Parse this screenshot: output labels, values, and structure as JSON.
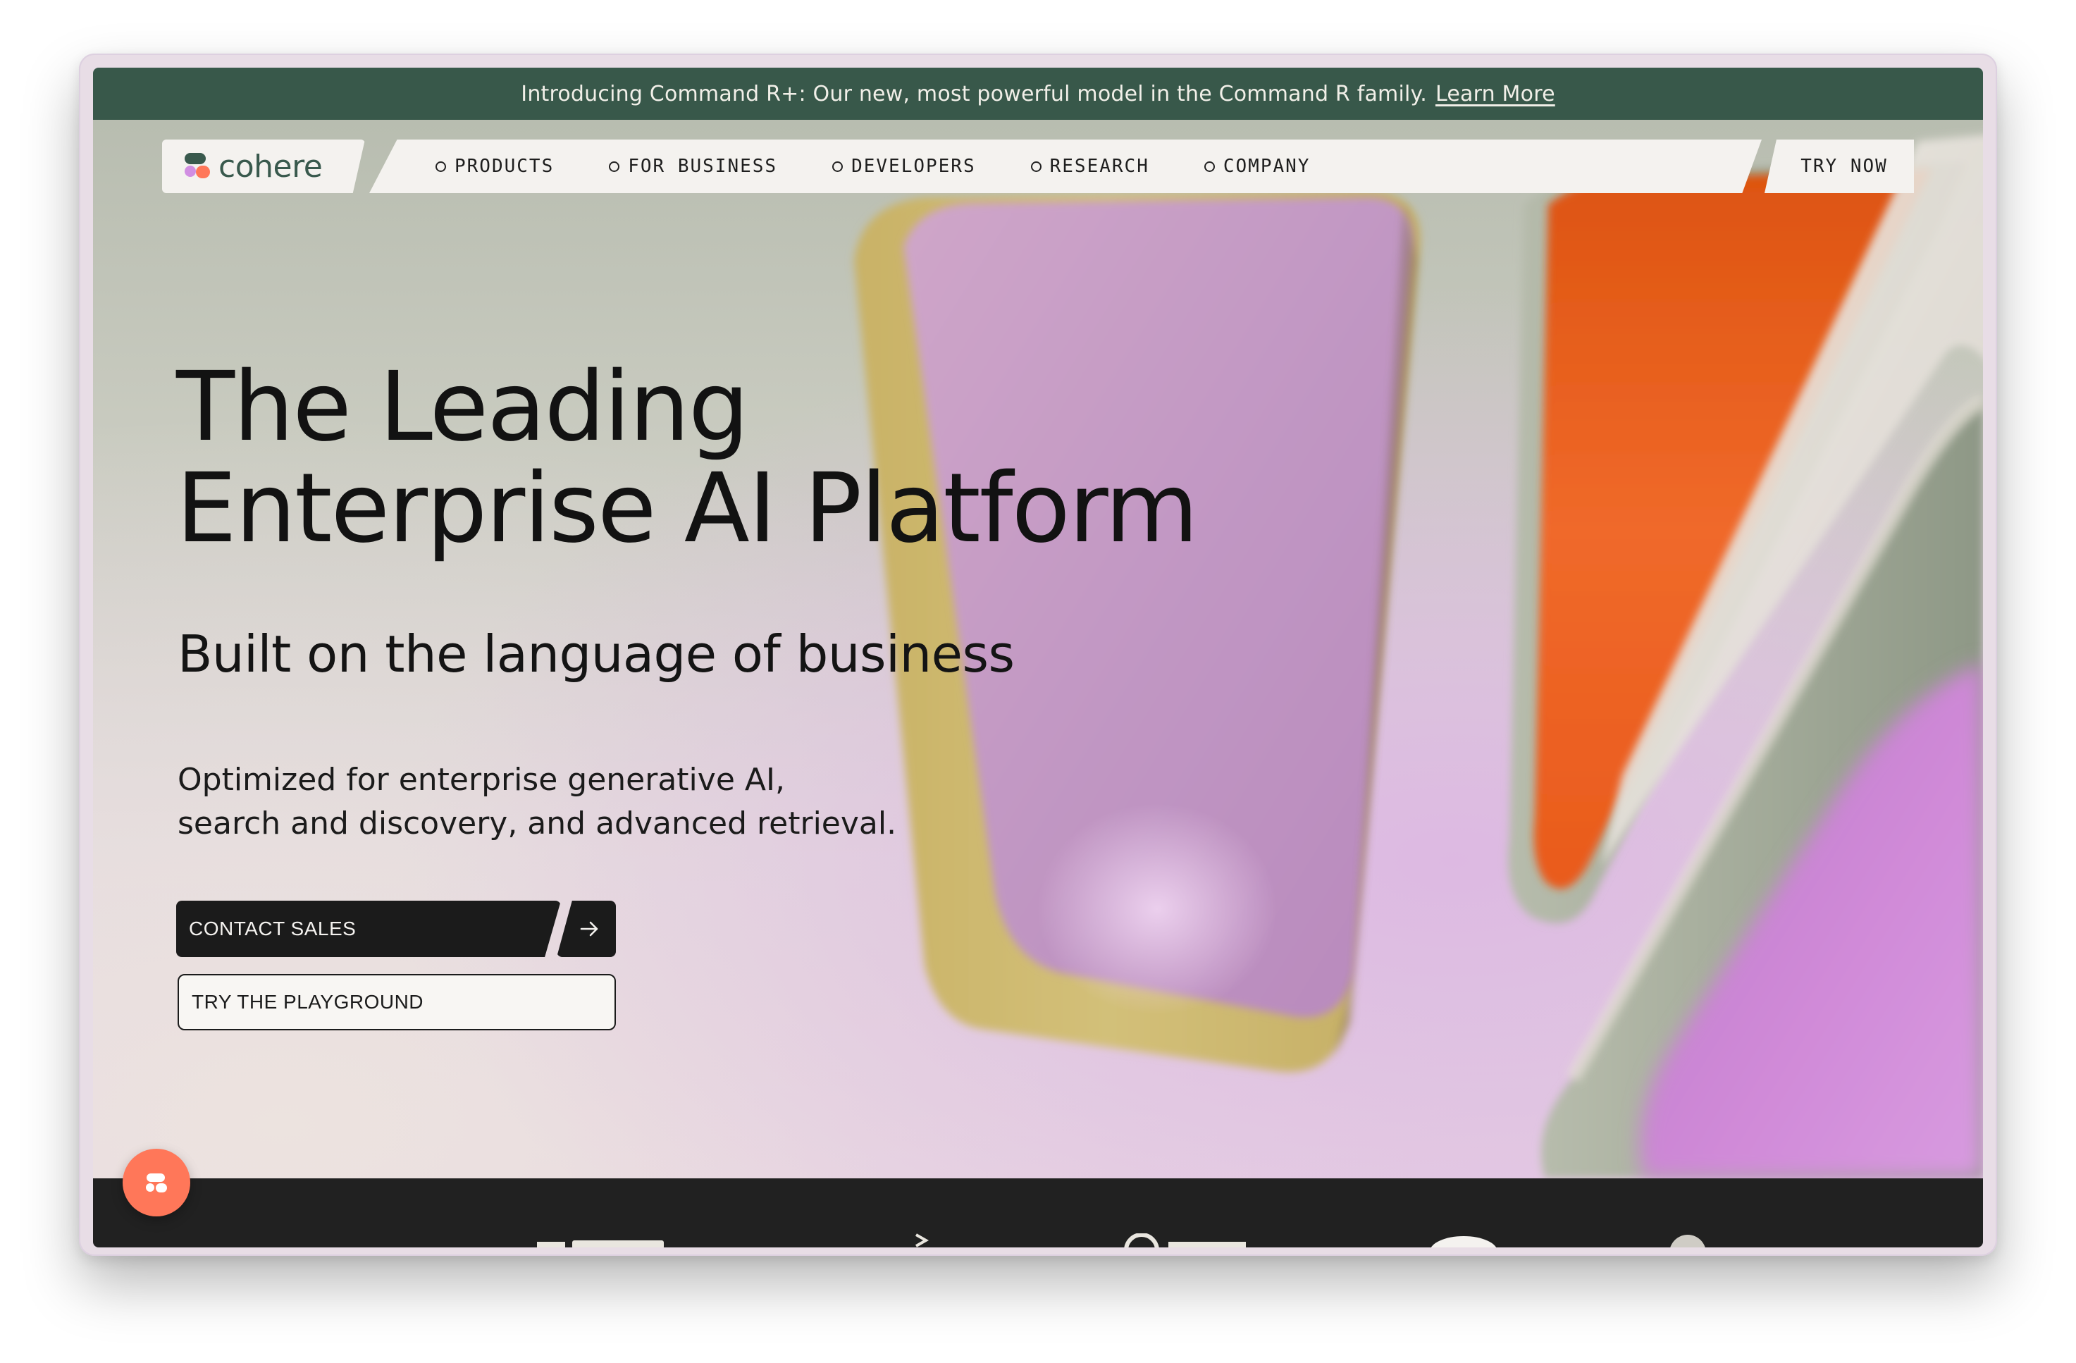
{
  "announcement": {
    "text": "Introducing Command R+: Our new, most powerful model in the Command R family.",
    "link_label": "Learn More"
  },
  "nav": {
    "logo_text": "cohere",
    "items": [
      {
        "label": "PRODUCTS"
      },
      {
        "label": "FOR BUSINESS"
      },
      {
        "label": "DEVELOPERS"
      },
      {
        "label": "RESEARCH"
      },
      {
        "label": "COMPANY"
      }
    ],
    "cta_label": "TRY NOW"
  },
  "hero": {
    "headline_line1": "The Leading",
    "headline_line2": "Enterprise AI Platform",
    "subheadline": "Built on the language of business",
    "body_line1": "Optimized for enterprise generative AI,",
    "body_line2": "search and discovery, and advanced retrieval.",
    "primary_button_label": "CONTACT SALES",
    "primary_button_icon": "arrow-right-icon",
    "secondary_button_label": "TRY THE PLAYGROUND"
  },
  "logo_strip": {
    "logos": [
      "partner-logo-1",
      "partner-logo-2",
      "partner-logo-3",
      "partner-logo-4",
      "partner-logo-5"
    ]
  },
  "chat_widget": {
    "icon": "cohere-chat-icon"
  },
  "colors": {
    "announcement_bg": "#38584A",
    "logo_green": "#39594D",
    "button_dark": "#1B1B1B",
    "chat_accent": "#FF7759",
    "strip_bg": "#212121"
  }
}
